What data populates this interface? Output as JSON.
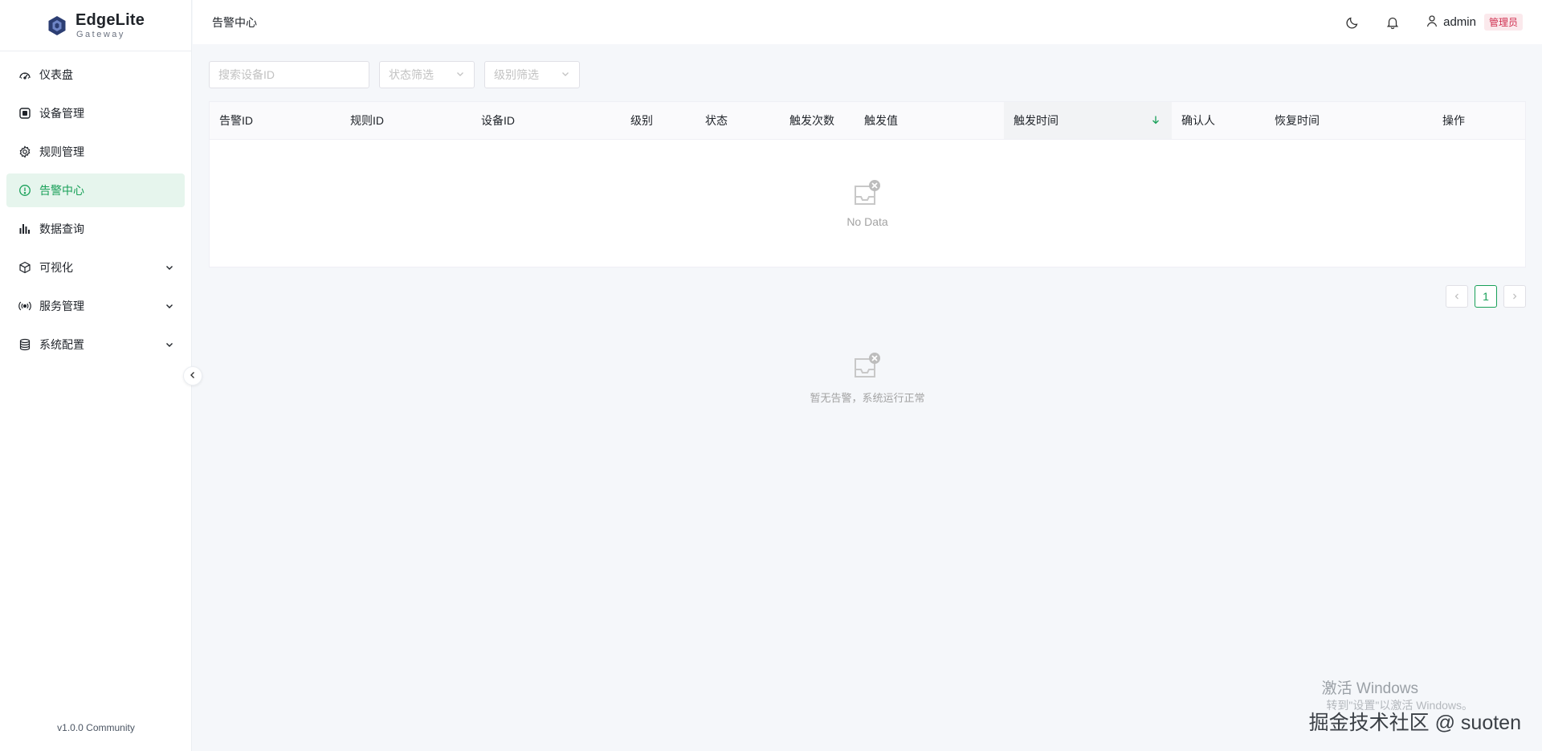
{
  "app": {
    "brand": "EdgeLite",
    "brand_sub": "Gateway",
    "version": "v1.0.0 Community"
  },
  "sidebar": {
    "items": [
      {
        "label": "仪表盘",
        "icon": "dashboard-icon"
      },
      {
        "label": "设备管理",
        "icon": "chip-icon"
      },
      {
        "label": "规则管理",
        "icon": "gear-icon"
      },
      {
        "label": "告警中心",
        "icon": "alert-circle-icon",
        "active": true
      },
      {
        "label": "数据查询",
        "icon": "bar-chart-icon"
      },
      {
        "label": "可视化",
        "icon": "cube-icon",
        "expandable": true
      },
      {
        "label": "服务管理",
        "icon": "broadcast-icon",
        "expandable": true
      },
      {
        "label": "系统配置",
        "icon": "database-icon",
        "expandable": true
      }
    ]
  },
  "header": {
    "breadcrumb": "告警中心",
    "user": "admin",
    "role": "管理员"
  },
  "filters": {
    "search_placeholder": "搜索设备ID",
    "status_placeholder": "状态筛选",
    "level_placeholder": "级别筛选"
  },
  "table": {
    "columns": [
      "告警ID",
      "规则ID",
      "设备ID",
      "级别",
      "状态",
      "触发次数",
      "触发值",
      "触发时间",
      "确认人",
      "恢复时间",
      "操作"
    ],
    "sorted_column": "触发时间",
    "empty_text": "No Data"
  },
  "pagination": {
    "current": "1"
  },
  "empty_state": {
    "text": "暂无告警，系统运行正常"
  },
  "watermark": {
    "line1": "激活 Windows",
    "line2": "转到\"设置\"以激活 Windows。",
    "credit": "掘金技术社区 @ suoten"
  },
  "colors": {
    "accent": "#18a058",
    "active_bg": "#e6f5ed",
    "role_badge": "#d03050",
    "logo": "#2c3e73"
  }
}
